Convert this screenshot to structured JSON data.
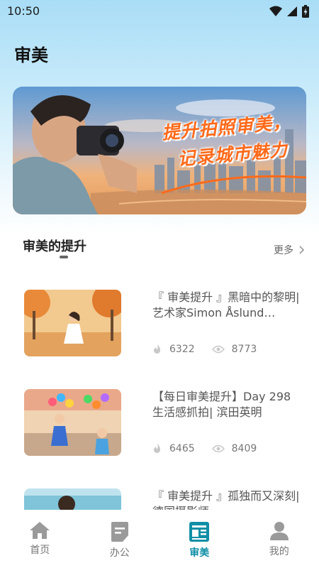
{
  "status_bar": {
    "time": "10:50",
    "icons": [
      "wifi-icon",
      "cellular-signal-icon",
      "battery-icon"
    ]
  },
  "header": {
    "title": "审美"
  },
  "banner": {
    "line1": "提升拍照审美，",
    "line2": "记录城市魅力"
  },
  "section": {
    "title": "审美的提升",
    "more_label": "更多"
  },
  "articles": [
    {
      "title": "『 审美提升 』黑暗中的黎明| 艺术家Simon Åslund…",
      "likes": "6322",
      "views": "8773"
    },
    {
      "title": "【每日审美提升】Day 298 生活感抓拍| 滨田英明",
      "likes": "6465",
      "views": "8409"
    },
    {
      "title": "『 审美提升 』孤独而又深刻| 德国摄影师…",
      "likes": "",
      "views": ""
    }
  ],
  "bottom_nav": [
    {
      "label": "首页",
      "icon": "home-icon",
      "active": false
    },
    {
      "label": "办公",
      "icon": "document-icon",
      "active": false
    },
    {
      "label": "审美",
      "icon": "newspaper-icon",
      "active": true
    },
    {
      "label": "我的",
      "icon": "person-icon",
      "active": false
    }
  ],
  "colors": {
    "accent": "#0f8fa6",
    "banner_text": "#ff6a1a"
  }
}
